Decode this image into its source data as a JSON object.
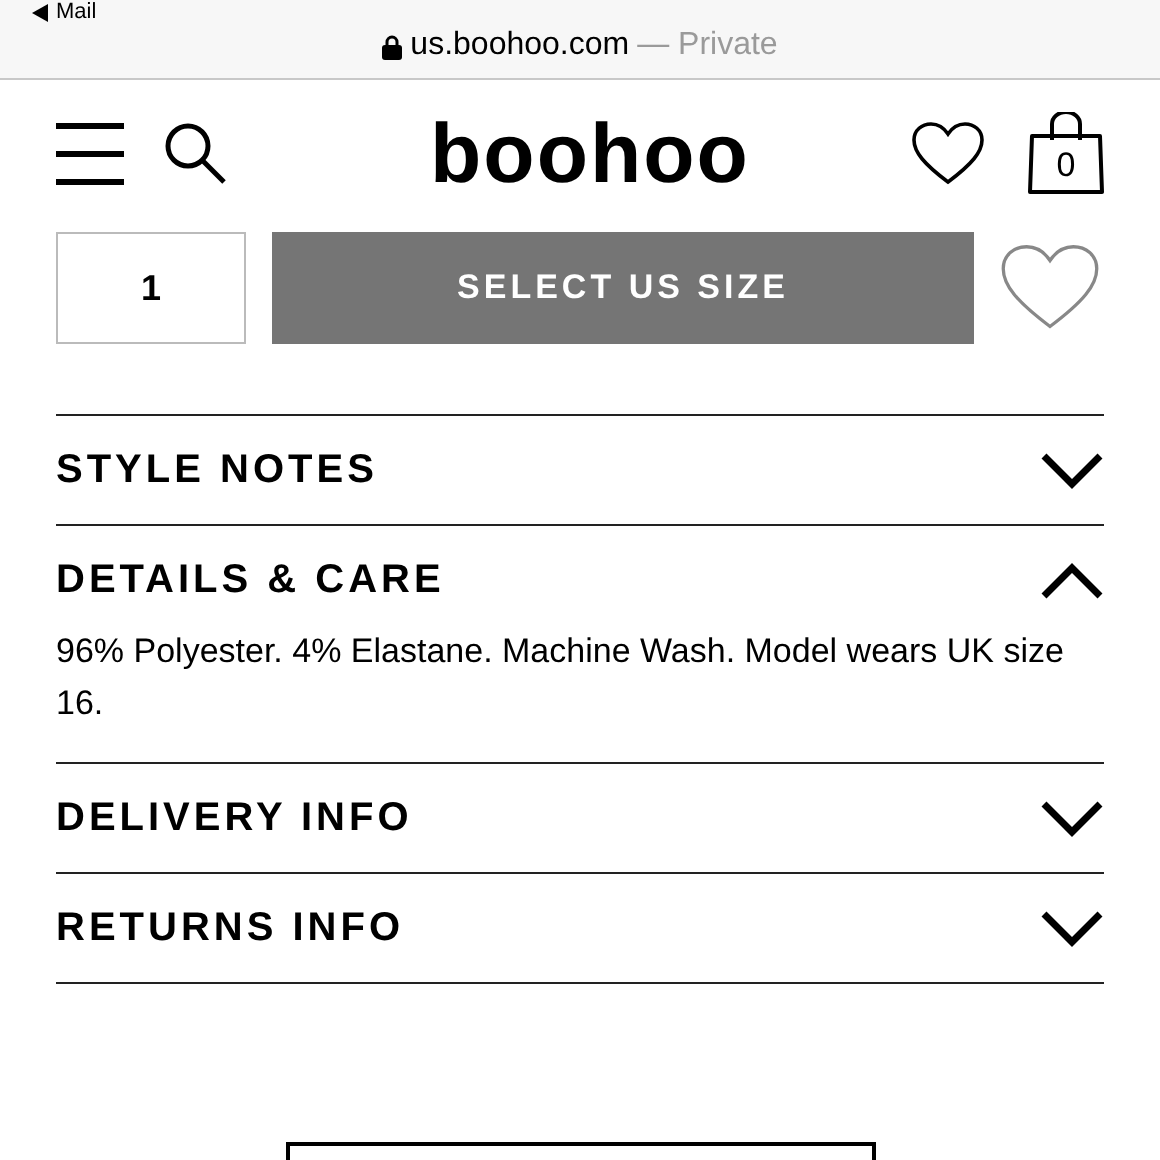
{
  "browser": {
    "back_label": "Mail",
    "url": "us.boohoo.com",
    "suffix": "— Private"
  },
  "header": {
    "logo": "boohoo",
    "bag_count": "0"
  },
  "purchase": {
    "quantity": "1",
    "button": "SELECT US SIZE"
  },
  "sections": [
    {
      "title": "STYLE NOTES",
      "expanded": false
    },
    {
      "title": "DETAILS & CARE",
      "expanded": true,
      "body": "96% Polyester. 4% Elastane. Machine Wash. Model wears UK size 16."
    },
    {
      "title": "DELIVERY INFO",
      "expanded": false
    },
    {
      "title": "RETURNS INFO",
      "expanded": false
    }
  ]
}
